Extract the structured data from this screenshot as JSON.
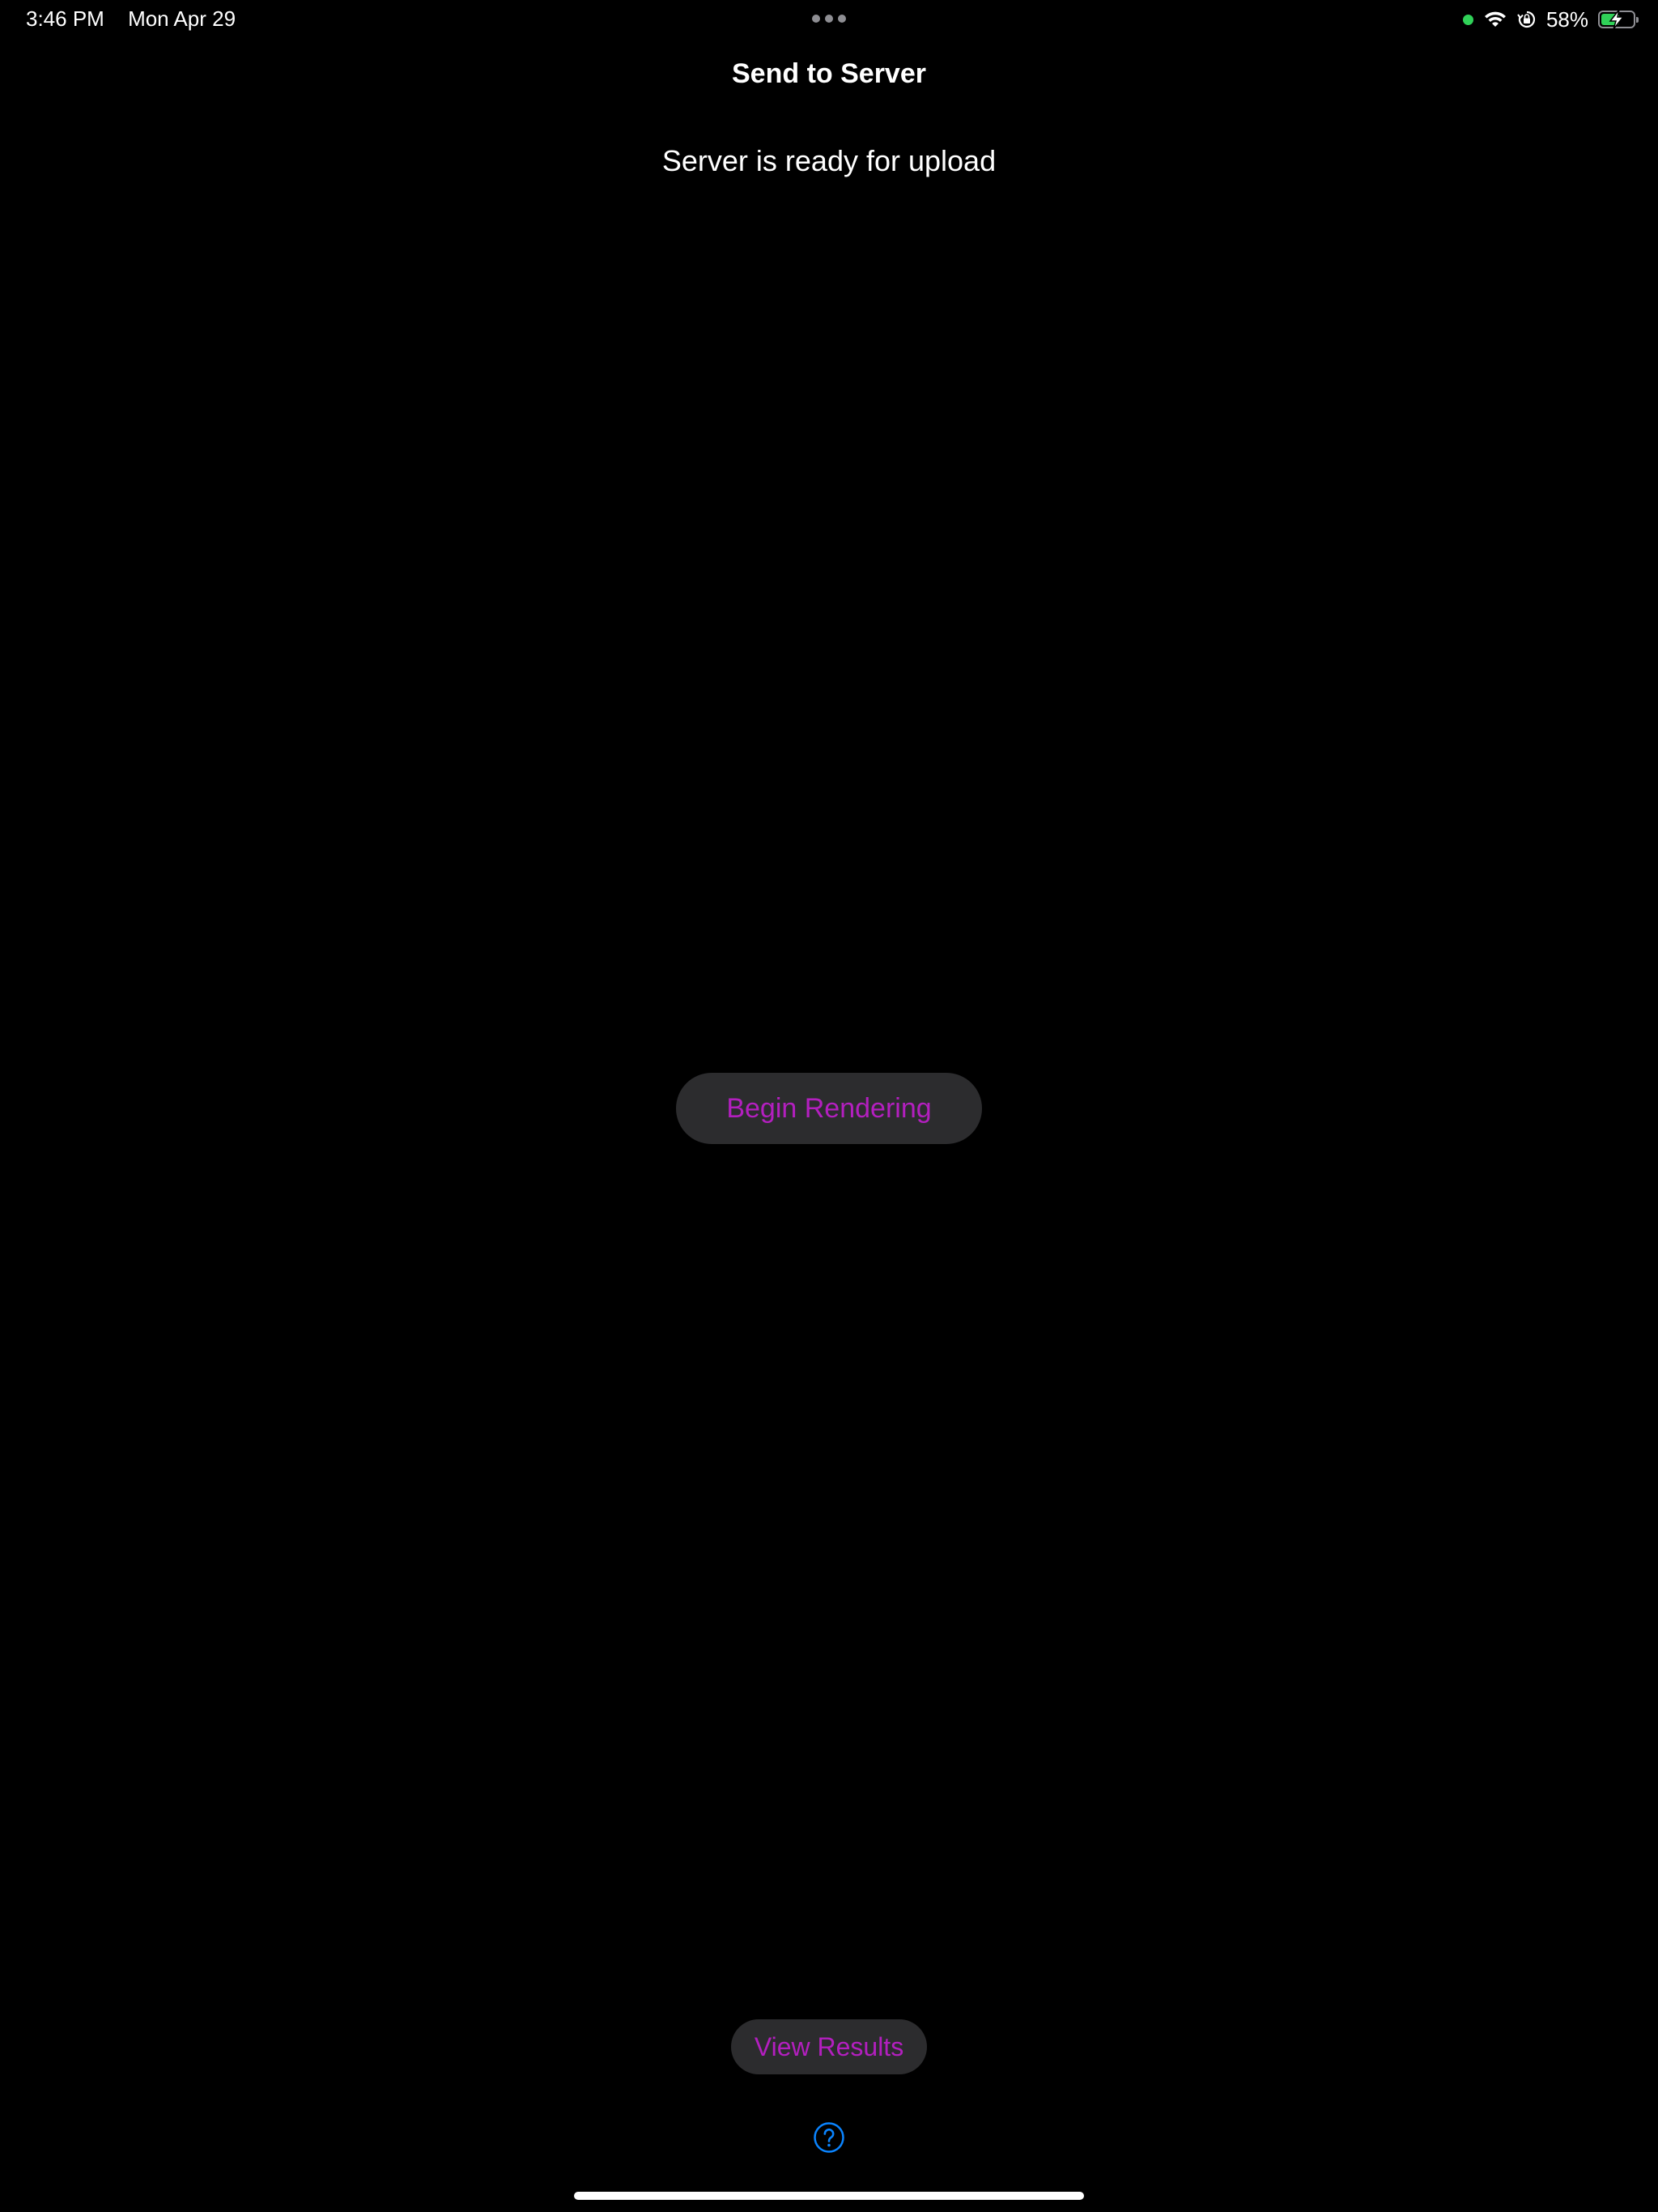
{
  "status_bar": {
    "time": "3:46 PM",
    "date": "Mon Apr 29",
    "battery_percent_label": "58%",
    "battery_level": 0.58,
    "charging": true,
    "icons": [
      "green-dot-indicator",
      "wifi-icon",
      "orientation-lock-icon",
      "battery-charging-icon"
    ]
  },
  "header": {
    "title": "Send to Server"
  },
  "main": {
    "status_message": "Server is ready for upload",
    "begin_button_label": "Begin Rendering",
    "view_results_label": "View Results",
    "help_icon": "question-circle-icon"
  },
  "colors": {
    "background": "#000000",
    "accent": "#b31fbf",
    "button_bg": "#2c2c2e",
    "help_blue": "#0a84ff",
    "indicator_green": "#30d158"
  }
}
